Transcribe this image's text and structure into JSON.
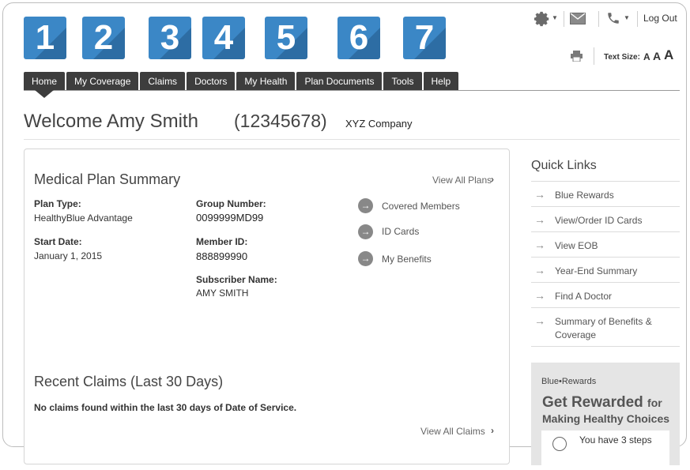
{
  "callouts": [
    "1",
    "2",
    "3",
    "4",
    "5",
    "6",
    "7"
  ],
  "utility": {
    "settings_icon": "gear-icon",
    "mail_icon": "envelope-icon",
    "phone_icon": "phone-icon",
    "logout": "Log Out",
    "print_icon": "printer-icon",
    "text_size_label": "Text Size:",
    "text_size_options": [
      "A",
      "A",
      "A"
    ]
  },
  "nav": {
    "tabs": [
      "Home",
      "My Coverage",
      "Claims",
      "Doctors",
      "My Health",
      "Plan Documents",
      "Tools",
      "Help"
    ],
    "active": "Home"
  },
  "header": {
    "welcome": "Welcome Amy Smith",
    "member_number": "(12345678)",
    "company": "XYZ Company"
  },
  "plan_summary": {
    "title": "Medical Plan Summary",
    "view_all": "View All Plans",
    "plan_type_label": "Plan Type:",
    "plan_type": "HealthyBlue Advantage",
    "start_date_label": "Start Date:",
    "start_date": "January 1, 2015",
    "group_number_label": "Group Number:",
    "group_number": "0099999MD99",
    "member_id_label": "Member ID:",
    "member_id": "888899990",
    "subscriber_label": "Subscriber Name:",
    "subscriber": "AMY SMITH",
    "links": [
      "Covered Members",
      "ID Cards",
      "My Benefits"
    ]
  },
  "claims": {
    "title": "Recent Claims (Last 30 Days)",
    "empty_message": "No claims found within the last 30 days of Date of Service.",
    "view_all": "View All Claims"
  },
  "quick_links": {
    "title": "Quick Links",
    "items": [
      "Blue Rewards",
      "View/Order ID Cards",
      "View EOB",
      "Year-End Summary",
      "Find A Doctor",
      "Summary of Benefits & Coverage"
    ]
  },
  "rewards": {
    "logo": "Blue•Rewards",
    "headline": "Get Rewarded",
    "headline_suffix": "for",
    "subhead": "Making Healthy Choices",
    "steps_text": "You have 3 steps"
  },
  "colors": {
    "callout_blue": "#3b87c6",
    "nav_dark": "#3d3d3d"
  }
}
